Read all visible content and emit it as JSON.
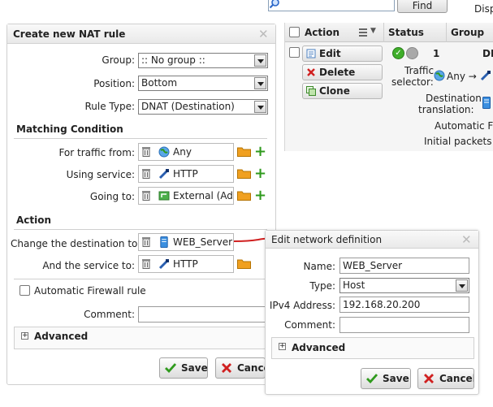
{
  "toolbar": {
    "find_label": "Find",
    "disp_text": "Disp"
  },
  "grid": {
    "columns": {
      "action": "Action",
      "status": "Status",
      "group": "Group"
    },
    "row": {
      "buttons": {
        "edit": "Edit",
        "delete": "Delete",
        "clone": "Clone"
      },
      "number": "1",
      "dn_text": "DN",
      "traffic_selector_label_line1": "Traffic",
      "traffic_selector_label_line2": "selector:",
      "traffic_selector_value": "Any →",
      "dest_translation_label_line1": "Destination",
      "dest_translation_label_line2": "translation:",
      "auto_firewall_text": "Automatic Fir",
      "initial_packets_text": "Initial packets a"
    }
  },
  "nat_dialog": {
    "title": "Create new NAT rule",
    "group": {
      "label": "Group:",
      "value": ":: No group ::"
    },
    "position": {
      "label": "Position:",
      "value": "Bottom"
    },
    "rule_type": {
      "label": "Rule Type:",
      "value": "DNAT (Destination)"
    },
    "matching_condition": {
      "title": "Matching Condition",
      "traffic_from": {
        "label": "For traffic from:",
        "value": "Any"
      },
      "using_service": {
        "label": "Using service:",
        "value": "HTTP"
      },
      "going_to": {
        "label": "Going to:",
        "value": "External (Add"
      }
    },
    "action": {
      "title": "Action",
      "change_destination": {
        "label": "Change the destination to:",
        "value": "WEB_Server"
      },
      "and_service": {
        "label": "And the service to:",
        "value": "HTTP"
      }
    },
    "auto_firewall_label": "Automatic Firewall rule",
    "comment_label": "Comment:",
    "comment_value": "",
    "advanced_label": "Advanced",
    "save_label": "Save",
    "cancel_label": "Cance"
  },
  "network_dialog": {
    "title": "Edit network definition",
    "name": {
      "label": "Name:",
      "value": "WEB_Server"
    },
    "type": {
      "label": "Type:",
      "value": "Host"
    },
    "ipv4": {
      "label": "IPv4 Address:",
      "value": "192.168.20.200"
    },
    "comment": {
      "label": "Comment:",
      "value": ""
    },
    "advanced_label": "Advanced",
    "save_label": "Save",
    "cancel_label": "Cancel"
  },
  "colors": {
    "accent_red": "#d02020",
    "accent_green": "#2f9a1d",
    "folder_orange": "#f0a020",
    "service_blue": "#2a5fb0"
  }
}
